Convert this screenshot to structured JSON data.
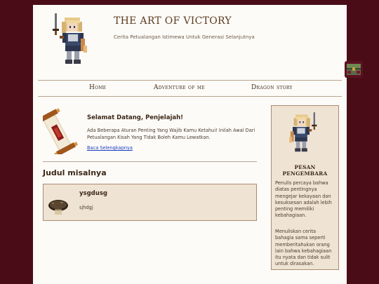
{
  "site": {
    "title": "THE ART OF VICTORY",
    "tagline": "Cerita Petualangan Istimewa Untuk Generasi Selanjutnya",
    "logo": "pixel-knight-sprite"
  },
  "nav": {
    "items": [
      {
        "label": "Home"
      },
      {
        "label": "Adventure of me"
      },
      {
        "label": "Dragon story"
      }
    ]
  },
  "welcome": {
    "icon": "scroll-icon",
    "title": "Selamat Datang, Penjelajah!",
    "text": "Ada Beberapa Aturan Penting Yang Wajib Kamu Ketahui! Inilah Awal Dari Petualangan Kisah Yang Tidak Boleh Kamu Lewatkan.",
    "link": "Baca Selengkapnya"
  },
  "posts": {
    "heading": "Judul misalnya",
    "items": [
      {
        "title": "ysgdusg",
        "excerpt": "sjhdgj",
        "icon": "mushroom-icon"
      }
    ]
  },
  "sidebar": {
    "title": "PESAN PENGEMBARA",
    "paragraphs": [
      "Penulis percaya bahwa diatas pentingnya mengejar kekayaan dan kesuksesan adalah lebih penting memiliki kebahagiaan.",
      "Menuliskan cerita bahagia sama seperti memberitahukan orang lain bahwa kebahagiaan itu nyata dan tidak sulit untuk dirasakan."
    ]
  },
  "colors": {
    "background": "#4a0d17",
    "page": "#fdfbf8",
    "panel": "#efe3d4",
    "border": "#a98c70",
    "heading": "#5a3b1e",
    "link": "#1a3fc0"
  },
  "widget": {
    "icon": "treasure-chest-icon"
  }
}
